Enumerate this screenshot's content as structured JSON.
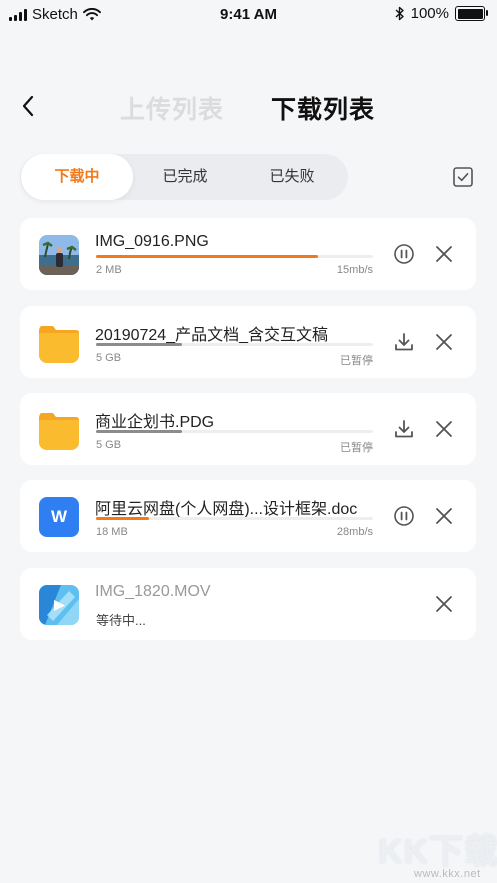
{
  "status_bar": {
    "carrier": "Sketch",
    "time": "9:41 AM",
    "battery": "100%"
  },
  "header": {
    "tab_upload": "上传列表",
    "tab_download": "下载列表"
  },
  "filter": {
    "items": [
      "下载中",
      "已完成",
      "已失败"
    ],
    "active": "下载中"
  },
  "colors": {
    "accent": "#f07a1c",
    "progress_paused": "#8c8c8c",
    "folder": "#fbb72c",
    "word_blue": "#2f7ff3"
  },
  "files": [
    {
      "name": "IMG_0916.PNG",
      "size": "2 MB",
      "status": "15mb/s",
      "progress": 0.8,
      "icon": "photo-thumbnail-icon",
      "action": "pause-icon"
    },
    {
      "name": "20190724_产品文档_含交互文稿",
      "size": "5 GB",
      "status": "已暂停",
      "progress": 0.31,
      "icon": "folder-icon",
      "action": "download-icon"
    },
    {
      "name": "商业企划书.PDG",
      "size": "5 GB",
      "status": "已暂停",
      "progress": 0.31,
      "icon": "folder-icon",
      "action": "download-icon"
    },
    {
      "name": "阿里云网盘(个人网盘)...设计框架.doc",
      "size": "18 MB",
      "status": "28mb/s",
      "progress": 0.19,
      "icon": "word-doc-icon",
      "icon_letter": "W",
      "action": "pause-icon"
    },
    {
      "name": "IMG_1820.MOV",
      "waiting": "等待中...",
      "icon": "video-thumbnail-icon"
    }
  ],
  "watermark": {
    "text": "KK下载",
    "url": "www.kkx.net"
  }
}
